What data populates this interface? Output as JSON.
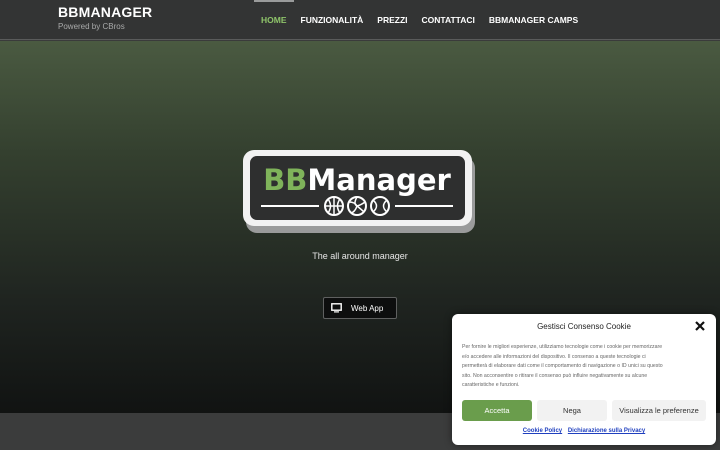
{
  "header": {
    "brand_title": "BBMANAGER",
    "brand_subtitle": "Powered by CBros",
    "nav": [
      {
        "label": "HOME",
        "active": true
      },
      {
        "label": "FUNZIONALITÀ",
        "active": false
      },
      {
        "label": "PREZZI",
        "active": false
      },
      {
        "label": "CONTATTACI",
        "active": false
      },
      {
        "label": "BBMANAGER CAMPS",
        "active": false
      }
    ]
  },
  "hero": {
    "logo_text_bb": "BB",
    "logo_text_manager": "Manager",
    "logo_icons": [
      "basketball-icon",
      "volleyball-icon",
      "tennis-ball-icon"
    ],
    "tagline": "The all around manager",
    "webapp_label": "Web App",
    "webapp_icon": "monitor-icon"
  },
  "cookie": {
    "title": "Gestisci Consenso Cookie",
    "text_lines": [
      "Per fornire le migliori esperienze, utilizziamo tecnologie come i cookie per memorizzare",
      "e/o accedere alle informazioni del dispositivo. Il consenso a queste tecnologie ci",
      "permetterà di elaborare dati come il comportamento di navigazione o ID unici su questo",
      "sito. Non acconsentire o ritirare il consenso può influire negativamente su alcune",
      "caratteristiche e funzioni."
    ],
    "accept_label": "Accetta",
    "deny_label": "Nega",
    "prefs_label": "Visualizza le preferenze",
    "link_cookie_policy": "Cookie Policy",
    "link_privacy": "Dichiarazione sulla Privacy"
  },
  "colors": {
    "accent_green": "#8fc46a",
    "accept_green": "#6a9d4c",
    "header_bg": "#333434",
    "link_blue": "#1f3fbf"
  }
}
